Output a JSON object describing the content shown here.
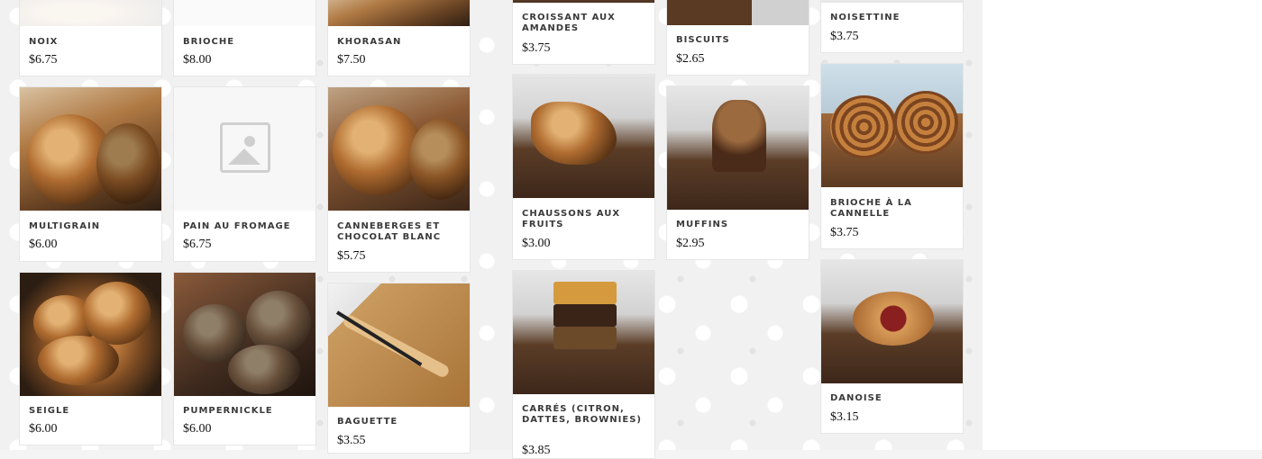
{
  "products": {
    "col1": [
      {
        "name": "NOIX",
        "price": "$6.75"
      },
      {
        "name": "MULTIGRAIN",
        "price": "$6.00"
      },
      {
        "name": "SEIGLE",
        "price": "$6.00"
      }
    ],
    "col2": [
      {
        "name": "BRIOCHE",
        "price": "$8.00"
      },
      {
        "name": "PAIN AU FROMAGE",
        "price": "$6.75"
      },
      {
        "name": "PUMPERNICKLE",
        "price": "$6.00"
      }
    ],
    "col3": [
      {
        "name": "KHORASAN",
        "price": "$7.50"
      },
      {
        "name": "CANNEBERGES ET CHOCOLAT BLANC",
        "price": "$5.75"
      },
      {
        "name": "BAGUETTE",
        "price": "$3.55"
      }
    ],
    "col4": [
      {
        "name": "CROISSANT AUX AMANDES",
        "price": "$3.75"
      },
      {
        "name": "CHAUSSONS AUX FRUITS",
        "price": "$3.00"
      },
      {
        "name": "CARRÉS (CITRON, DATTES, BROWNIES)",
        "price": "$3.85"
      }
    ],
    "col5": [
      {
        "name": "BISCUITS",
        "price": "$2.65"
      },
      {
        "name": "MUFFINS",
        "price": "$2.95"
      }
    ],
    "col6": [
      {
        "name": "NOISETTINE",
        "price": "$3.75"
      },
      {
        "name": "BRIOCHE À LA CANNELLE",
        "price": "$3.75"
      },
      {
        "name": "DANOISE",
        "price": "$3.15"
      }
    ]
  },
  "placeholder_icon": "image-placeholder-icon"
}
